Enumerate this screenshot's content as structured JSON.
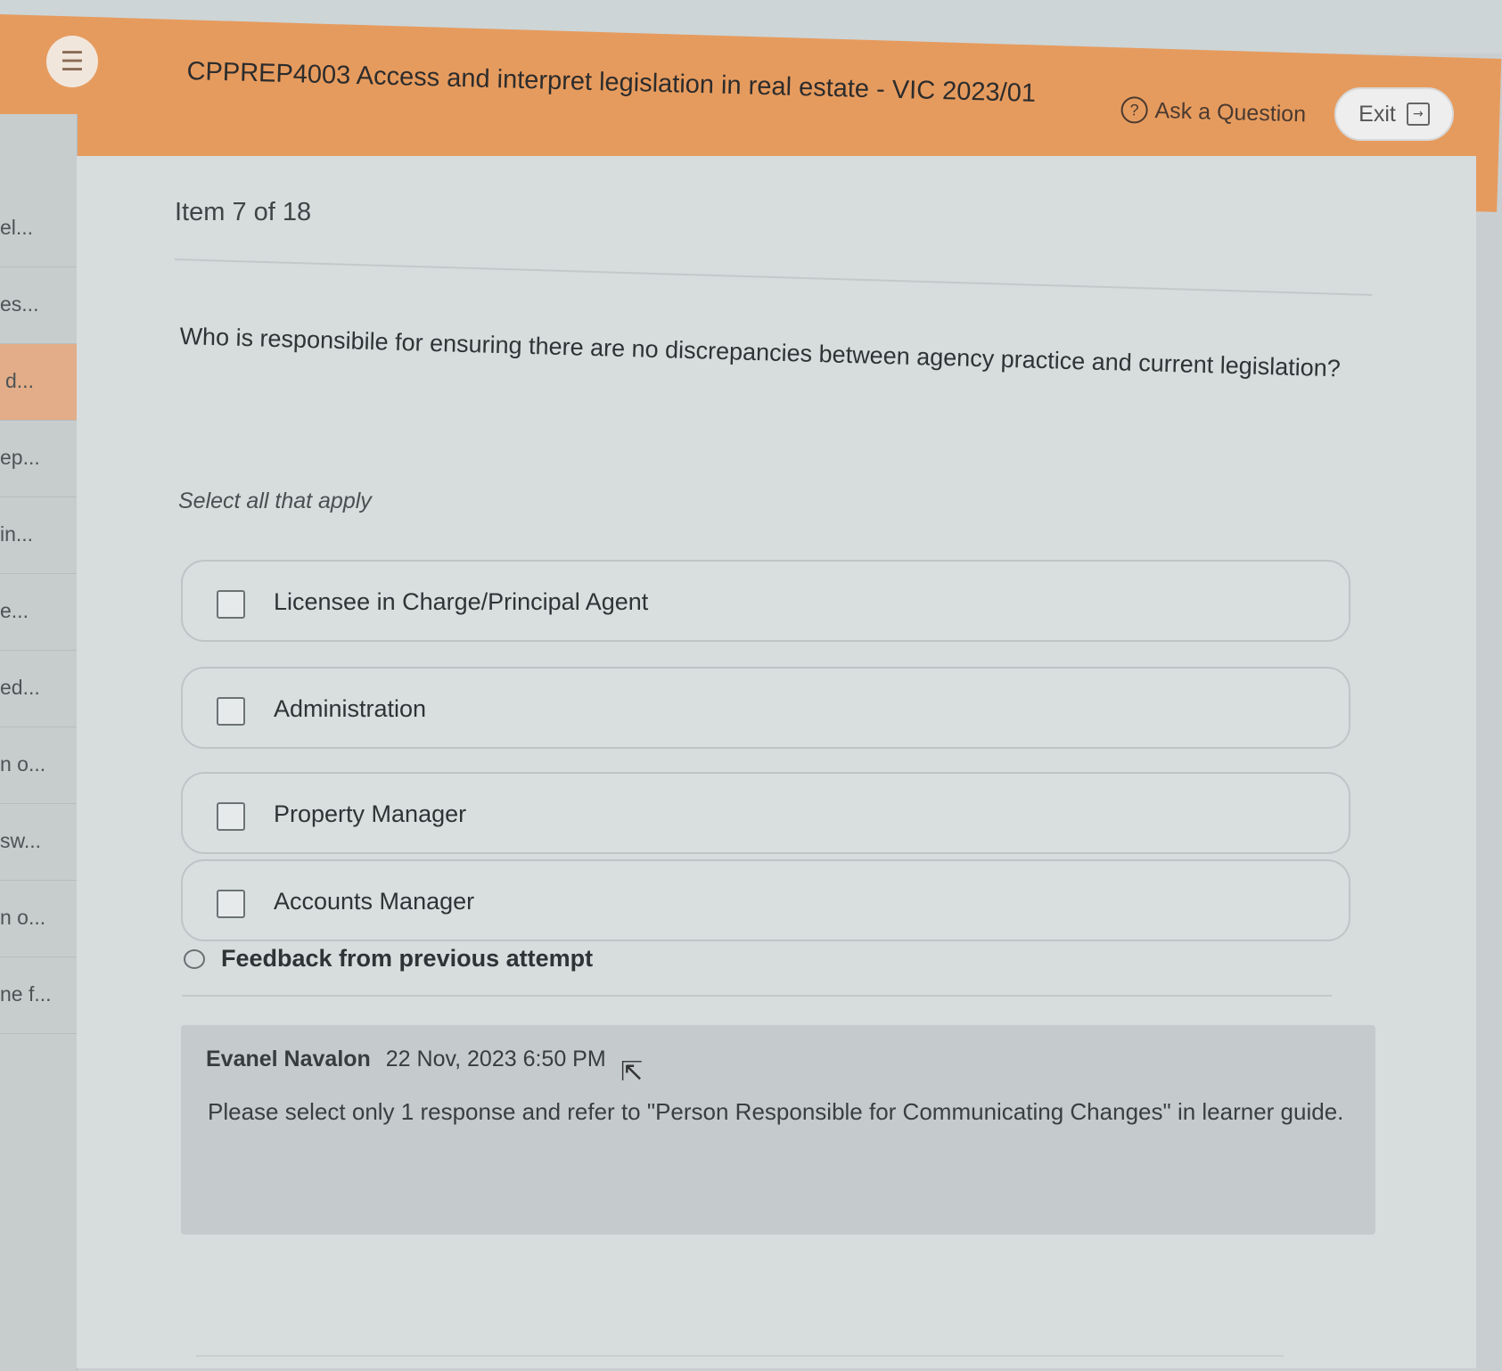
{
  "header": {
    "title": "CPPREP4003 Access and interpret legislation in real estate - VIC 2023/01",
    "ask_label": "Ask a Question",
    "exit_label": "Exit",
    "menu_icon": "hamburger-menu-icon",
    "accent_color": "#e69b5e"
  },
  "sidebar": {
    "items": [
      {
        "label": "el..."
      },
      {
        "label": "es..."
      },
      {
        "label": "d...",
        "active": true
      },
      {
        "label": "ep..."
      },
      {
        "label": "in..."
      },
      {
        "label": "e..."
      },
      {
        "label": "ed..."
      },
      {
        "label": "n o..."
      },
      {
        "label": "sw..."
      },
      {
        "label": "n o..."
      },
      {
        "label": "ne f..."
      }
    ]
  },
  "main": {
    "item_count": "Item 7 of 18",
    "question": "Who is responsibile for ensuring there are no discrepancies between agency practice and current legislation?",
    "instruction": "Select all that apply",
    "options": [
      {
        "label": "Licensee in Charge/Principal Agent",
        "checked": false
      },
      {
        "label": "Administration",
        "checked": false
      },
      {
        "label": "Property Manager",
        "checked": false
      },
      {
        "label": "Accounts Manager",
        "checked": false
      }
    ],
    "feedback_toggle_label": "Feedback from previous attempt",
    "feedback": {
      "author": "Evanel Navalon",
      "timestamp": "22 Nov, 2023 6:50 PM",
      "text": "Please select only 1 response and refer to \"Person Responsible for Communicating Changes\" in learner guide."
    }
  }
}
